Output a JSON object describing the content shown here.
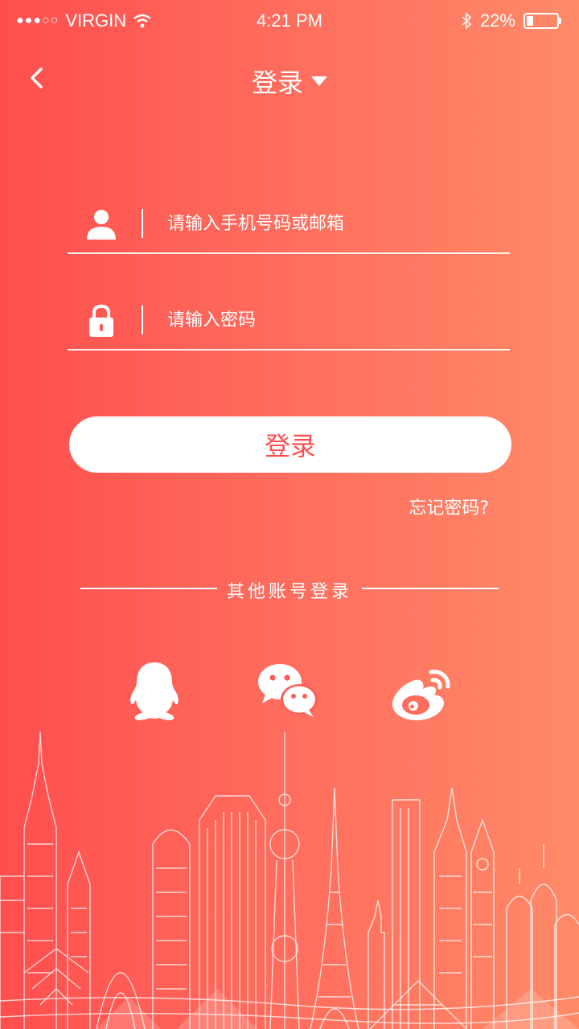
{
  "status_bar": {
    "signal_dots": "●●●○○",
    "carrier": "VIRGIN",
    "time": "4:21 PM",
    "battery_percent": "22%",
    "battery_level": 0.22
  },
  "header": {
    "back_icon": "chevron-left-icon",
    "title": "登录",
    "dropdown_icon": "caret-down-icon"
  },
  "form": {
    "account": {
      "icon": "user-icon",
      "value": "",
      "placeholder": "请输入手机号码或邮箱"
    },
    "password": {
      "icon": "lock-icon",
      "value": "",
      "placeholder": "请输入密码"
    },
    "login_button": "登录",
    "forgot_password": "忘记密码?"
  },
  "other_login": {
    "label": "其他账号登录",
    "providers": [
      {
        "icon": "qq-icon"
      },
      {
        "icon": "wechat-icon"
      },
      {
        "icon": "weibo-icon"
      }
    ]
  },
  "colors": {
    "gradient_start": "#ff4e4e",
    "gradient_end": "#ff8a68",
    "button_text": "#ff4f4f"
  }
}
